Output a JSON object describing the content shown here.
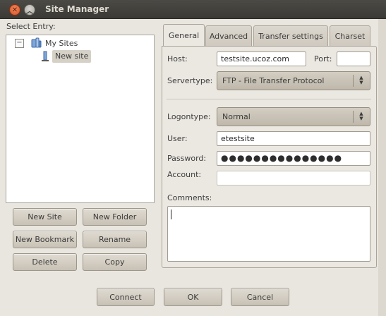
{
  "window": {
    "title": "Site Manager"
  },
  "left": {
    "select_entry_label": "Select Entry:",
    "tree": {
      "expander": "−",
      "root_label": "My Sites",
      "child_label": "New site"
    },
    "buttons": {
      "new_site": "New Site",
      "new_folder": "New Folder",
      "new_bookmark": "New Bookmark",
      "rename": "Rename",
      "delete": "Delete",
      "copy": "Copy"
    }
  },
  "tabs": [
    {
      "label": "General"
    },
    {
      "label": "Advanced"
    },
    {
      "label": "Transfer settings"
    },
    {
      "label": "Charset"
    }
  ],
  "general": {
    "host_label": "Host:",
    "host_value": "testsite.ucoz.com",
    "port_label": "Port:",
    "port_value": "",
    "servertype_label": "Servertype:",
    "servertype_value": "FTP - File Transfer Protocol",
    "logontype_label": "Logontype:",
    "logontype_value": "Normal",
    "user_label": "User:",
    "user_value": "etestsite",
    "password_label": "Password:",
    "password_value": "●●●●●●●●●●●●●●●",
    "account_label": "Account:",
    "account_value": "",
    "comments_label": "Comments:"
  },
  "footer": {
    "connect": "Connect",
    "ok": "OK",
    "cancel": "Cancel"
  },
  "icons": {
    "close": "close-icon",
    "maximize": "chevron-up-icon",
    "folder": "folder-icon",
    "site": "site-icon",
    "combo_arrows": "updown-arrows-icon"
  }
}
